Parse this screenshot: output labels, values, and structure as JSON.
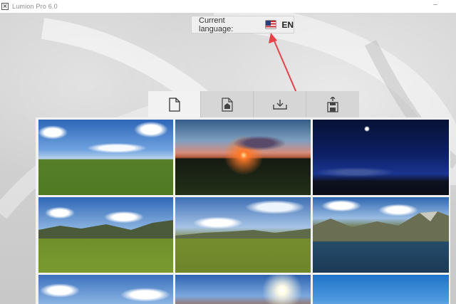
{
  "window": {
    "title": "Lumion Pro 6.0",
    "minimize_glyph": "–"
  },
  "language": {
    "label": "Current language:",
    "code": "EN",
    "flag_icon": "us-flag-icon"
  },
  "tabs": [
    {
      "name": "new-scene",
      "icon": "new-file-icon",
      "active": true
    },
    {
      "name": "load-scene",
      "icon": "load-file-icon",
      "active": false
    },
    {
      "name": "import-scene",
      "icon": "import-tray-icon",
      "active": false
    },
    {
      "name": "save-scene",
      "icon": "save-disk-icon",
      "active": false
    }
  ],
  "scenes": [
    {
      "name": "scene-grass-clouds"
    },
    {
      "name": "scene-sunset"
    },
    {
      "name": "scene-night"
    },
    {
      "name": "scene-hills-grass"
    },
    {
      "name": "scene-plain-mountains"
    },
    {
      "name": "scene-lake-mountains"
    },
    {
      "name": "scene-clouds-sky"
    },
    {
      "name": "scene-sun-desert"
    },
    {
      "name": "scene-blue-sky"
    }
  ],
  "colors": {
    "annotation_arrow": "#e8414a",
    "panel_background": "#f1f1f1",
    "tab_active": "#f2f2f2",
    "tab_inactive": "#d6d6d6"
  }
}
